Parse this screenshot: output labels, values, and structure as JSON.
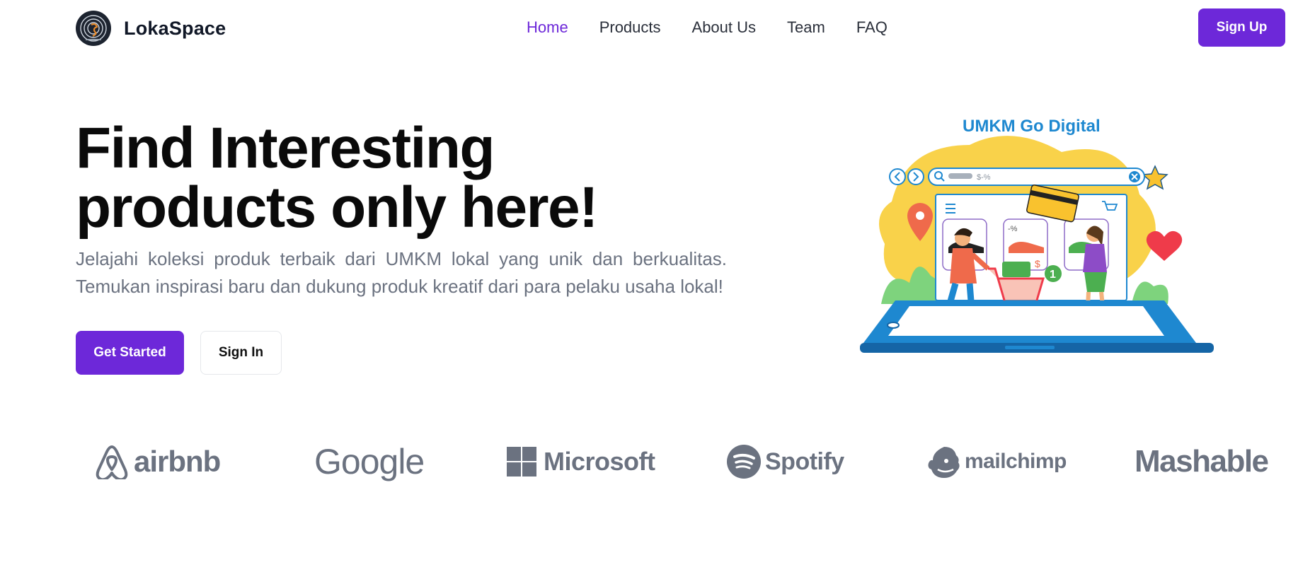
{
  "nav": {
    "brand_name": "LokaSpace",
    "links": [
      {
        "label": "Home",
        "active": true
      },
      {
        "label": "Products",
        "active": false
      },
      {
        "label": "About Us",
        "active": false
      },
      {
        "label": "Team",
        "active": false
      },
      {
        "label": "FAQ",
        "active": false
      }
    ],
    "signup_label": "Sign Up"
  },
  "hero": {
    "title_line1": "Find Interesting",
    "title_line2": "products only here!",
    "description": "Jelajahi koleksi produk terbaik dari UMKM lokal yang unik dan berkualitas. Temukan inspirasi baru dan dukung produk kreatif dari para pelaku usaha lokal!",
    "primary_button": "Get Started",
    "secondary_button": "Sign In"
  },
  "illustration": {
    "title": "UMKM Go Digital",
    "search_placeholder": "$-%",
    "discount_label": "-%",
    "price_label": "$",
    "cart_count": "1"
  },
  "partners": [
    {
      "name": "airbnb",
      "icon": "airbnb-icon"
    },
    {
      "name": "Google",
      "icon": ""
    },
    {
      "name": "Microsoft",
      "icon": "windows-grid-icon"
    },
    {
      "name": "Spotify",
      "icon": "spotify-icon"
    },
    {
      "name": "mailchimp",
      "icon": "mailchimp-icon"
    },
    {
      "name": "Mashable",
      "icon": ""
    }
  ],
  "colors": {
    "accent": "#6d28d9",
    "logo_gray": "#6b7280",
    "illus_blue": "#1e88d0"
  }
}
